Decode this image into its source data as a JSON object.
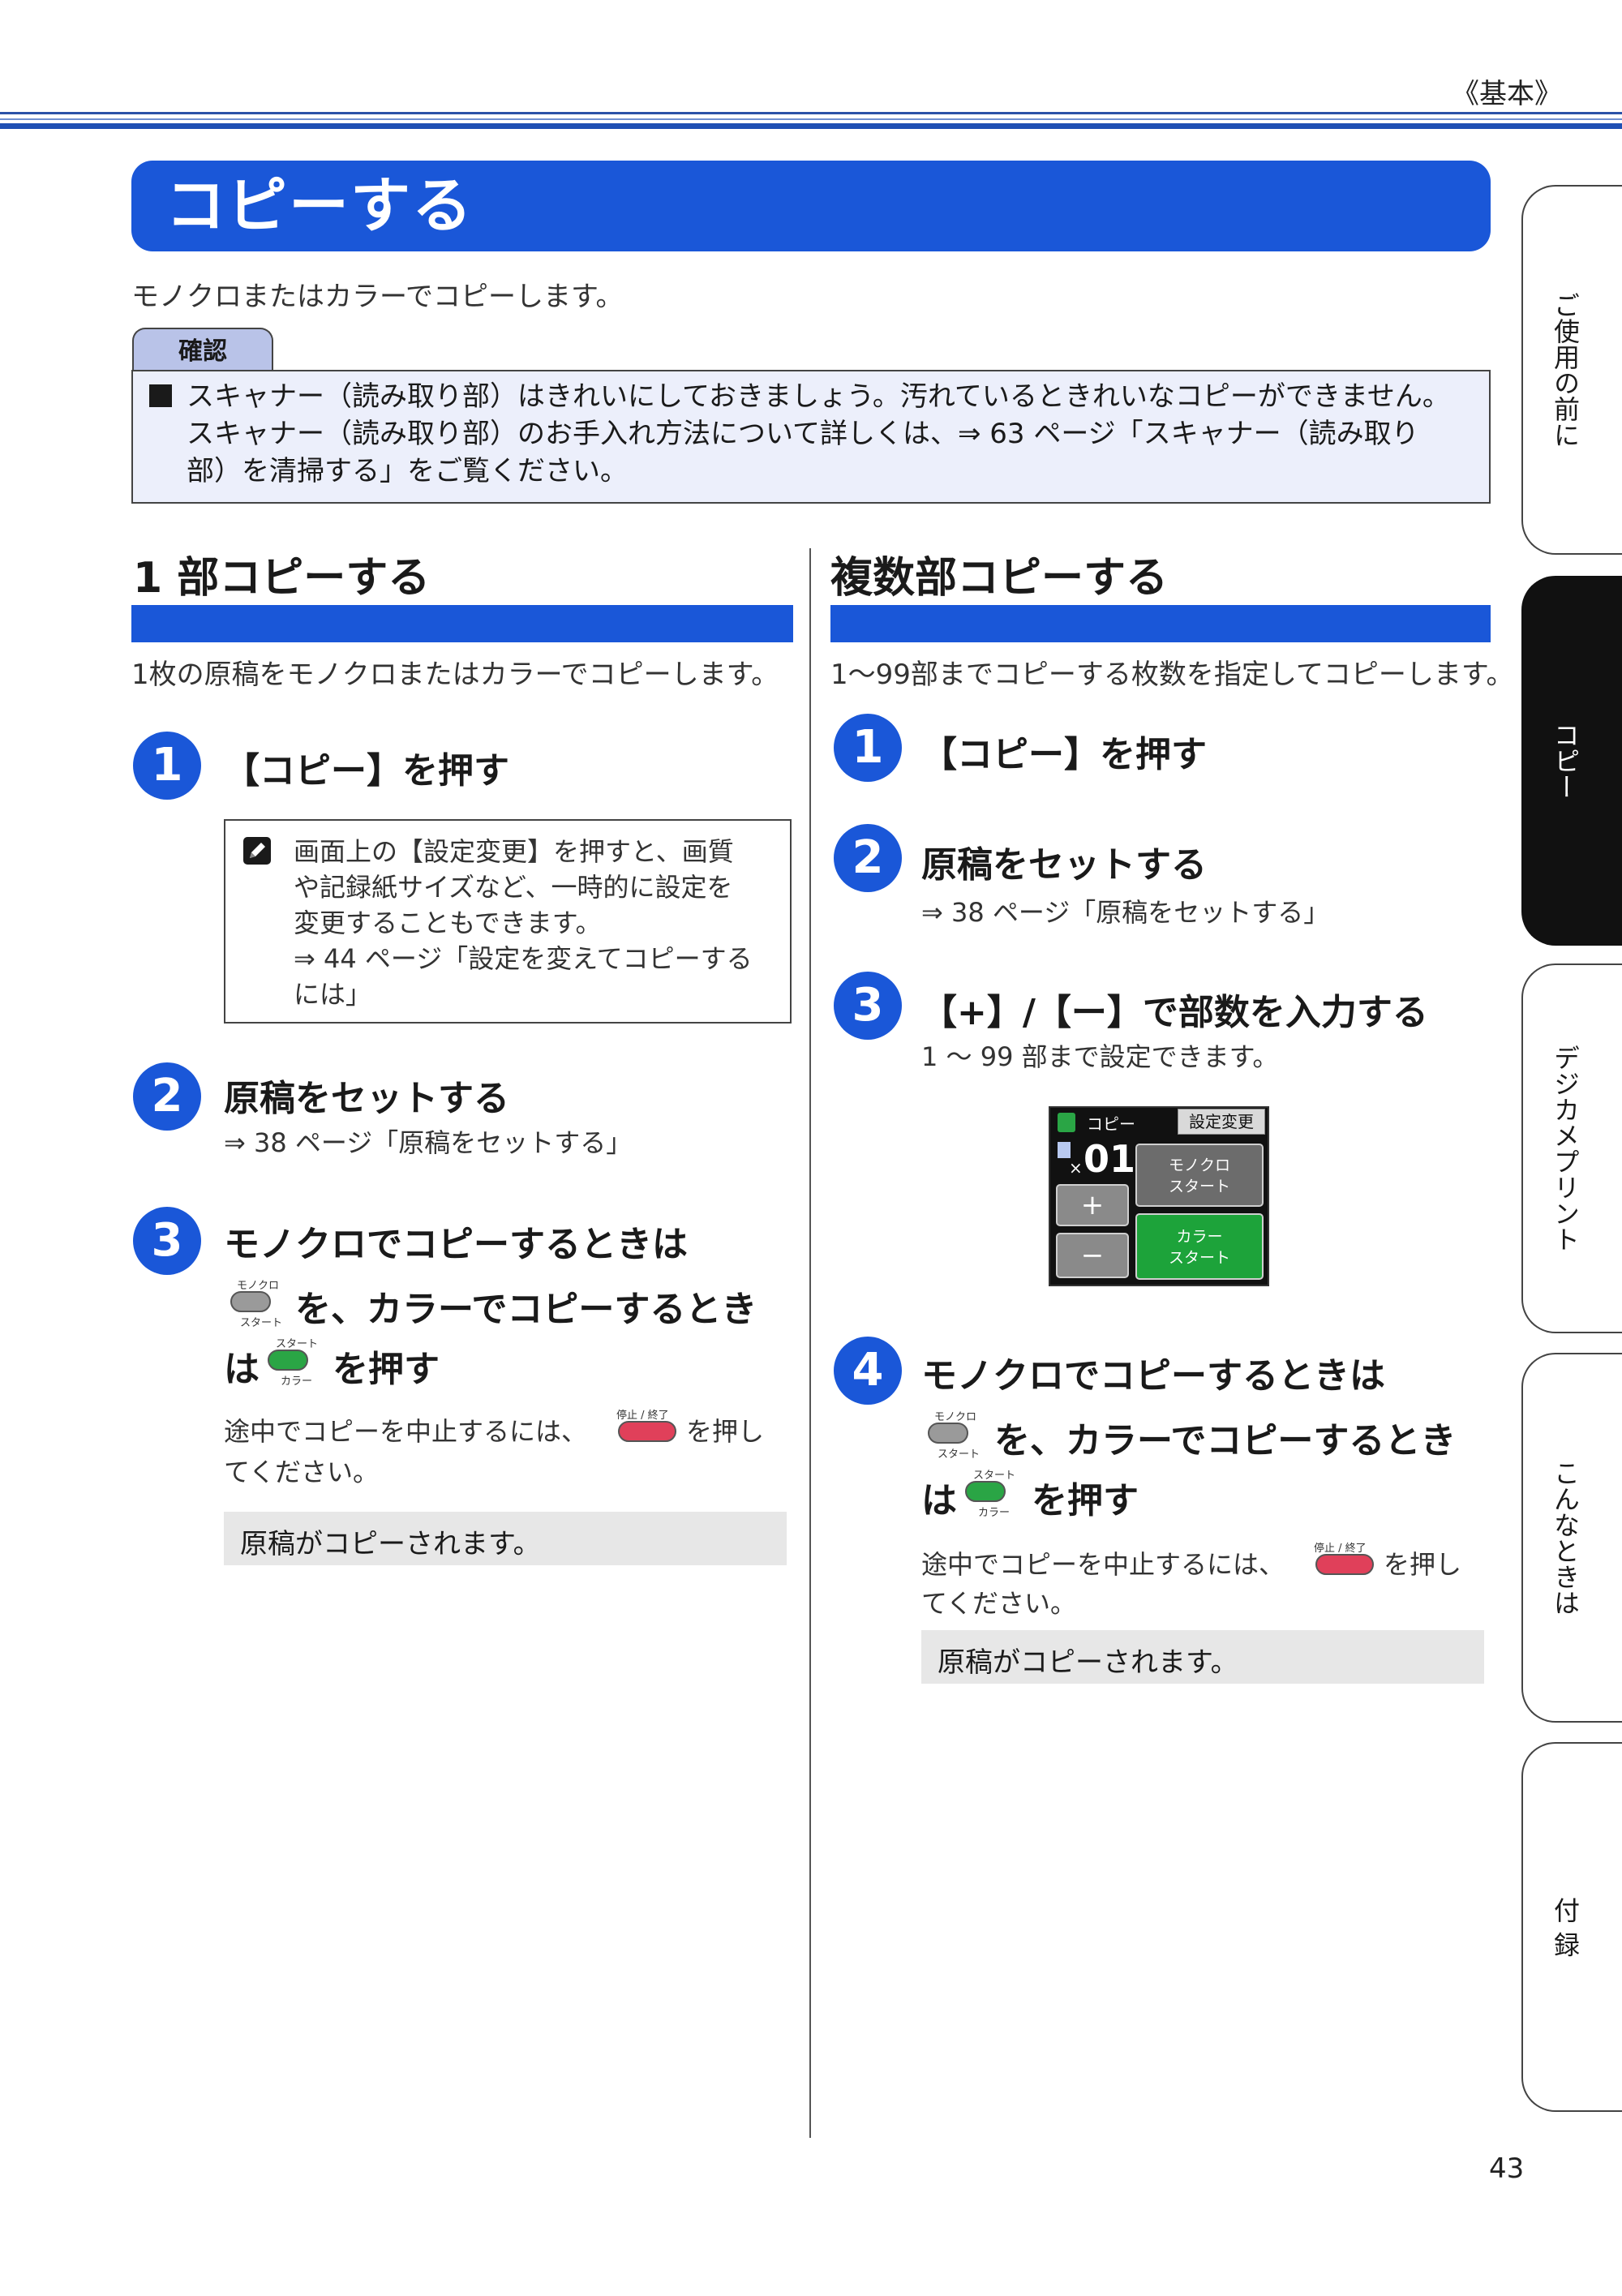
{
  "header": {
    "section_label": "《基本》"
  },
  "title": "コピーする",
  "intro": "モノクロまたはカラーでコピーします。",
  "confirm": {
    "tab_label": "確認",
    "lines": [
      "スキャナー（読み取り部）はきれいにしておきましょう。汚れているときれいなコピーができません。",
      "スキャナー（読み取り部）のお手入れ方法について詳しくは、⇒ 63 ページ「スキャナー（読み取り",
      "部）を清掃する」をご覧ください。"
    ]
  },
  "left": {
    "heading": "1 部コピーする",
    "desc": "1枚の原稿をモノクロまたはカラーでコピーします。",
    "step1": {
      "num": "1",
      "title": "【コピー】を押す"
    },
    "memo": [
      "画面上の【設定変更】を押すと、画質",
      "や記録紙サイズなど、一時的に設定を",
      "変更することもできます。",
      "⇒ 44 ページ「設定を変えてコピーする",
      "には」"
    ],
    "step2": {
      "num": "2",
      "title": "原稿をセットする",
      "ref": "⇒ 38 ページ「原稿をセットする」"
    },
    "step3": {
      "num": "3",
      "line1": "モノクロでコピーするときは",
      "line2": "を、カラーでコピーするとき",
      "line3a": "は",
      "line3b": "を押す",
      "note1a": "途中でコピーを中止するには、",
      "note1b": "を押し",
      "note2": "てください。"
    },
    "result": "原稿がコピーされます。"
  },
  "right": {
    "heading": "複数部コピーする",
    "desc": "1～99部までコピーする枚数を指定してコピーします。",
    "step1": {
      "num": "1",
      "title": "【コピー】を押す"
    },
    "step2": {
      "num": "2",
      "title": "原稿をセットする",
      "ref": "⇒ 38 ページ「原稿をセットする」"
    },
    "step3": {
      "num": "3",
      "title": "【+】/【ー】で部数を入力する",
      "note": "1 ～ 99 部まで設定できます。"
    },
    "step4": {
      "num": "4",
      "line1": "モノクロでコピーするときは",
      "line2": "を、カラーでコピーするとき",
      "line3a": "は",
      "line3b": "を押す",
      "note1a": "途中でコピーを中止するには、",
      "note1b": "を押し",
      "note2": "てください。"
    },
    "result": "原稿がコピーされます。"
  },
  "buttons": {
    "mono_top": "モノクロ",
    "mono_bottom": "スタート",
    "color_top": "スタート",
    "color_bottom": "カラー",
    "stop_label": "停止 / 終了",
    "colors": {
      "mono": "#9a9a9a",
      "color": "#2aa545",
      "stop": "#e0405a"
    }
  },
  "lcd": {
    "title": "コピー",
    "settings_button": "設定変更",
    "copies": "01",
    "multiplier": "×",
    "mono_line1": "モノクロ",
    "mono_line2": "スタート",
    "color_line1": "カラー",
    "color_line2": "スタート",
    "plus": "+",
    "minus": "−"
  },
  "side_tabs": [
    {
      "label": "ご使用の前に",
      "active": false
    },
    {
      "label": "コピー",
      "active": true
    },
    {
      "label": "デジカメプリント",
      "active": false
    },
    {
      "label": "こんなときは",
      "active": false
    },
    {
      "label": "付 録",
      "active": false
    }
  ],
  "page_number": "43",
  "colors": {
    "accent": "#1a57d8",
    "confirm_bg": "#eceffb",
    "result_bg": "#e7e7e7"
  }
}
